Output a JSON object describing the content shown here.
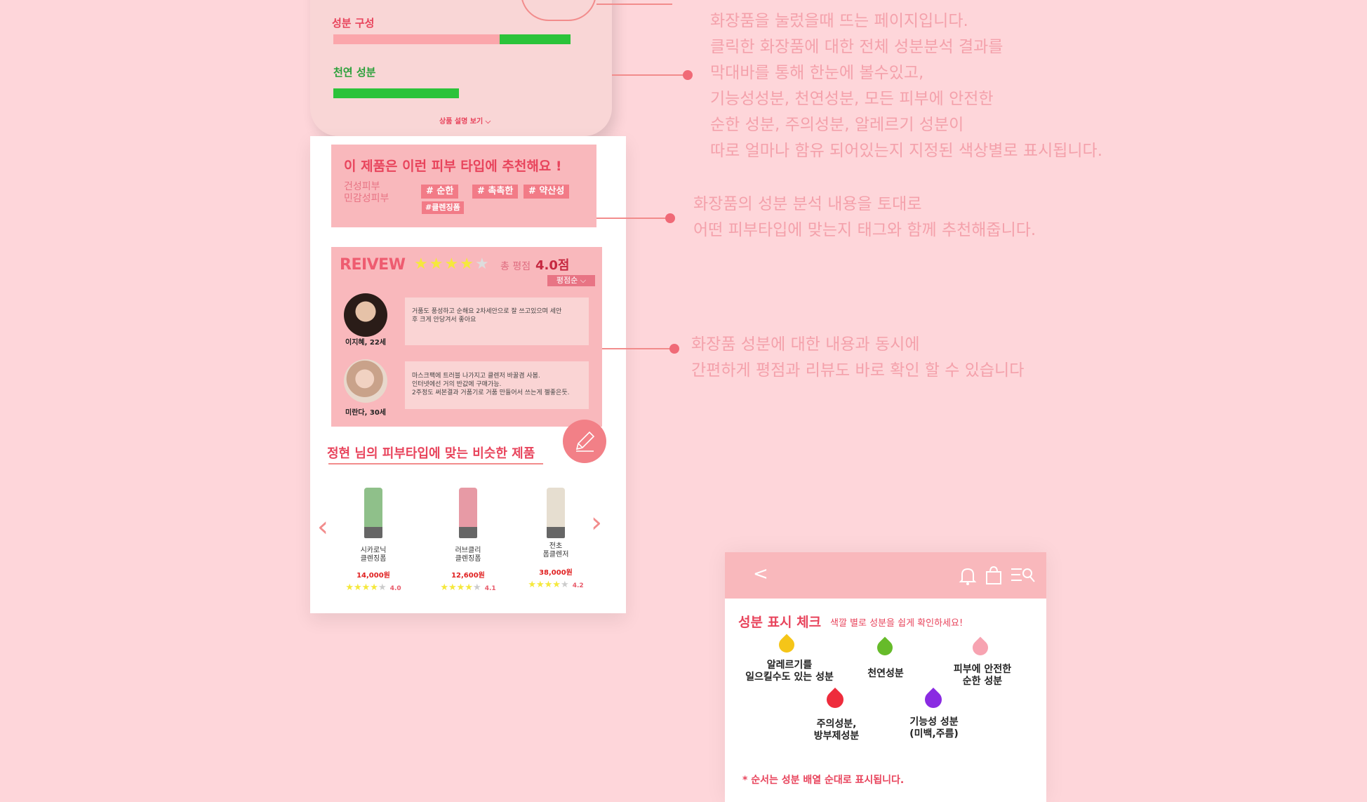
{
  "ingredient_card": {
    "composition_label": "성분 구성",
    "natural_label": "천연 성분",
    "composition_pct": 70,
    "natural_pct": 53,
    "detail_link": "상품 설명 보기 ⌵"
  },
  "recommend": {
    "title": "이 제품은 이런 피부 타입에 추천해요 !",
    "skin_types": [
      "건성피부",
      "민감성피부"
    ],
    "tags": [
      "# 순한",
      "# 촉촉한",
      "# 약산성",
      "#클렌징폼"
    ]
  },
  "review": {
    "title": "REIVEW",
    "rating_label": "총 평점",
    "rating_value": "4.0점",
    "rating": 4,
    "sort_label": "평점순",
    "items": [
      {
        "name": "이지혜, 22세",
        "text_line1": "거품도 풍성하고 순해요  2차세안으로 잘 쓰고있으며 세안",
        "text_line2": "후 크게 안당겨서 좋아요",
        "text_line3": ""
      },
      {
        "name": "미란다, 30세",
        "text_line1": "마스크팩에 트러블 나가지고 클렌저 바꿀겸 사봄.",
        "text_line2": "인터넷에선 거의 반값에 구매가능.",
        "text_line3": "2주정도 써본결과 거품기로 거품 만들어서 쓰는게 젤좋은듯."
      }
    ]
  },
  "similar": {
    "title": "정현 님의 피부타입에 맞는 비슷한 제품",
    "products": [
      {
        "name_line1": "시카로닉",
        "name_line2": "클렌징폼",
        "price": "14,000원",
        "score": "4.0",
        "rating": 4,
        "color": "#8fc08a"
      },
      {
        "name_line1": "러브클리",
        "name_line2": "클렌징폼",
        "price": "12,600원",
        "score": "4.1",
        "rating": 4,
        "color": "#e79aa5"
      },
      {
        "name_line1": "전초",
        "name_line2": "폼클렌저",
        "price": "38,000원",
        "score": "4.2",
        "rating": 4,
        "color": "#e6ded0"
      }
    ]
  },
  "annotations": {
    "a1": [
      "화장품을 눌렀을때 뜨는 페이지입니다.",
      "클릭한 화장품에 대한 전체 성분분석 결과를",
      "막대바를 통해 한눈에 볼수있고,",
      "기능성성분, 천연성분, 모든 피부에 안전한",
      "순한 성분, 주의성분, 알레르기 성분이",
      "따로 얼마나 함유 되어있는지 지정된 색상별로 표시됩니다."
    ],
    "a2": [
      "화장품의 성분 분석 내용을 토대로",
      "어떤 피부타입에 맞는지 태그와 함께 추천해줍니다."
    ],
    "a3": [
      "화장품 성분에 대한 내용과 동시에",
      "간편하게 평점과 리뷰도 바로 확인 할 수 있습니다"
    ]
  },
  "legend_card": {
    "back_label": "<",
    "title": "성분 표시 체크",
    "subtitle": "색깔 별로 성분을 쉽게  확인하세요!",
    "items": [
      {
        "line1": "알레르기를",
        "line2": "일으킬수도 있는 성분",
        "color": "#f5c518"
      },
      {
        "line1": "천연성분",
        "line2": "",
        "color": "#66bb2a"
      },
      {
        "line1": "피부에 안전한",
        "line2": "순한 성분",
        "color": "#f7a3b1"
      },
      {
        "line1": "주의성분,",
        "line2": "방부제성분",
        "color": "#ee2c3c"
      },
      {
        "line1": "기능성 성분",
        "line2": "(미백,주름)",
        "color": "#8a2be2"
      }
    ],
    "footnote": "* 순서는 성분 배열 순대로 표시됩니다."
  },
  "colors": {
    "accent": "#e8445c",
    "green": "#2cc33a",
    "pink": "#f9b8bc"
  }
}
